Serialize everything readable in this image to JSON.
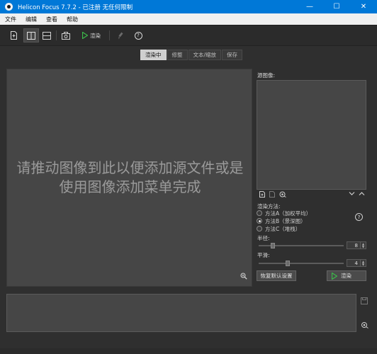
{
  "window": {
    "title": "Helicon Focus 7.7.2 - 已注册  无任何限制",
    "minimize": "—",
    "maximize": "☐",
    "close": "✕"
  },
  "menu": [
    "文件",
    "编辑",
    "查看",
    "帮助"
  ],
  "toolbar": {
    "render_label": "渲染",
    "help_glyph": "?",
    "icons": [
      "open-file-icon",
      "two-panel-layout-icon",
      "stacked-layout-icon",
      "camera-icon",
      "render-icon",
      "brush-icon",
      "help-icon"
    ]
  },
  "tabs": [
    {
      "label": "渲染中",
      "active": true
    },
    {
      "label": "修整",
      "active": false
    },
    {
      "label": "文本/缩放",
      "active": false
    },
    {
      "label": "保存",
      "active": false
    }
  ],
  "viewer": {
    "message": "请推动图像到此以便添加源文件或是使用图像添加菜单完成"
  },
  "source_images": {
    "label": "源图像:"
  },
  "render_method": {
    "label": "渲染方法:",
    "options": [
      {
        "label": "方法A（加权平均）",
        "selected": false
      },
      {
        "label": "方法B（景深图）",
        "selected": true
      },
      {
        "label": "方法C（堆栈）",
        "selected": false
      }
    ],
    "help": "?"
  },
  "radius": {
    "label": "半径:",
    "value": "8",
    "level": 0.15
  },
  "smoothing": {
    "label": "平滑:",
    "value": "4",
    "level": 0.33
  },
  "buttons": {
    "reset_label": "恢复默认设置",
    "render_label": "渲染"
  },
  "colors": {
    "titlebar": "#0078d7",
    "render_play": "#3cb94a"
  }
}
